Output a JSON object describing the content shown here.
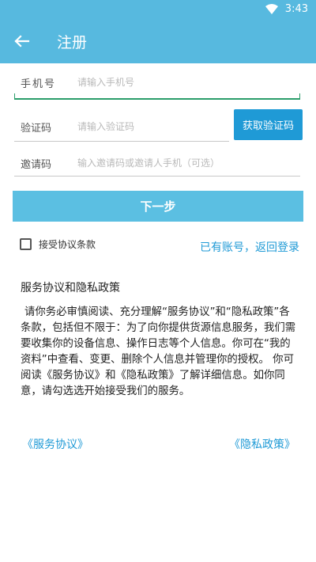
{
  "status_bar": {
    "time": "3:43",
    "wifi_icon": "wifi-icon"
  },
  "app_bar": {
    "title": "注册",
    "back_icon": "arrow-left-icon"
  },
  "form": {
    "phone": {
      "label": "手机号",
      "placeholder": "请输入手机号",
      "value": ""
    },
    "code": {
      "label": "验证码",
      "placeholder": "请输入验证码",
      "value": "",
      "button": "获取验证码"
    },
    "invite": {
      "label": "邀请码",
      "placeholder": "输入邀请码或邀请人手机（可选）",
      "value": ""
    }
  },
  "next_button": "下一步",
  "agree": {
    "label": "接受协议条款",
    "checked": false
  },
  "login_link": "已有账号，返回登录",
  "policy": {
    "title": "服务协议和隐私政策",
    "body": "请你务必审慎阅读、充分理解“服务协议”和“隐私政策”各条款，包括但不限于：为了向你提供货源信息服务，我们需要收集你的设备信息、操作日志等个人信息。你可在“我的资料”中查看、变更、删除个人信息并管理你的授权。 你可阅读《服务协议》和《隐私政策》了解详细信息。如你同意，请勾选选开始接受我们的服务。",
    "service_link": "《服务协议》",
    "privacy_link": "《隐私政策》"
  },
  "colors": {
    "primary": "#57b9df",
    "accent": "#1f9ad6",
    "button": "#5bbfe2",
    "focus_line": "#2a9d6a"
  }
}
